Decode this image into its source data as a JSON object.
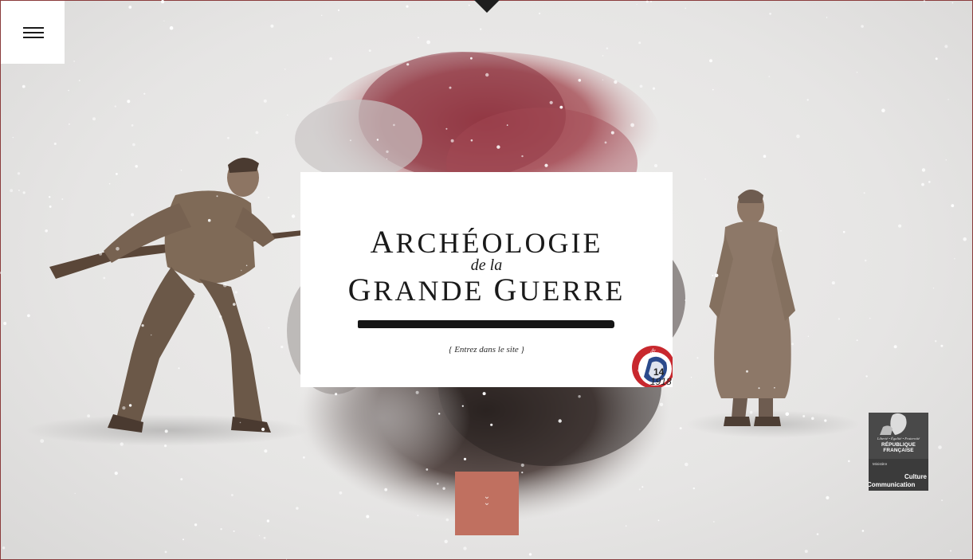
{
  "site": {
    "title_line1_cap": "A",
    "title_line1_rest": "RCHÉOLOGIE",
    "title_line2": "de la",
    "title_line3_cap1": "G",
    "title_line3_rest1": "RANDE ",
    "title_line3_cap2": "G",
    "title_line3_rest2": "UERRE",
    "enter_link": "{ Entrez dans le site }"
  },
  "badge": {
    "label": "CENTENAIRE",
    "years_top": "14",
    "years_bottom": "1918"
  },
  "ministry": {
    "motto": "Liberté • Égalité • Fraternité",
    "republic": "RÉPUBLIQUE FRANÇAISE",
    "minister": "Ministère",
    "line1": "Culture",
    "line2": "Communication"
  },
  "colors": {
    "border": "#8a3b3b",
    "scroll_button": "#c07060",
    "splash_red": "#8e3a44",
    "card": "#ffffff"
  },
  "icons": {
    "menu": "hamburger-icon",
    "top": "triangle-down-icon",
    "scroll": "chevron-down-icon"
  }
}
